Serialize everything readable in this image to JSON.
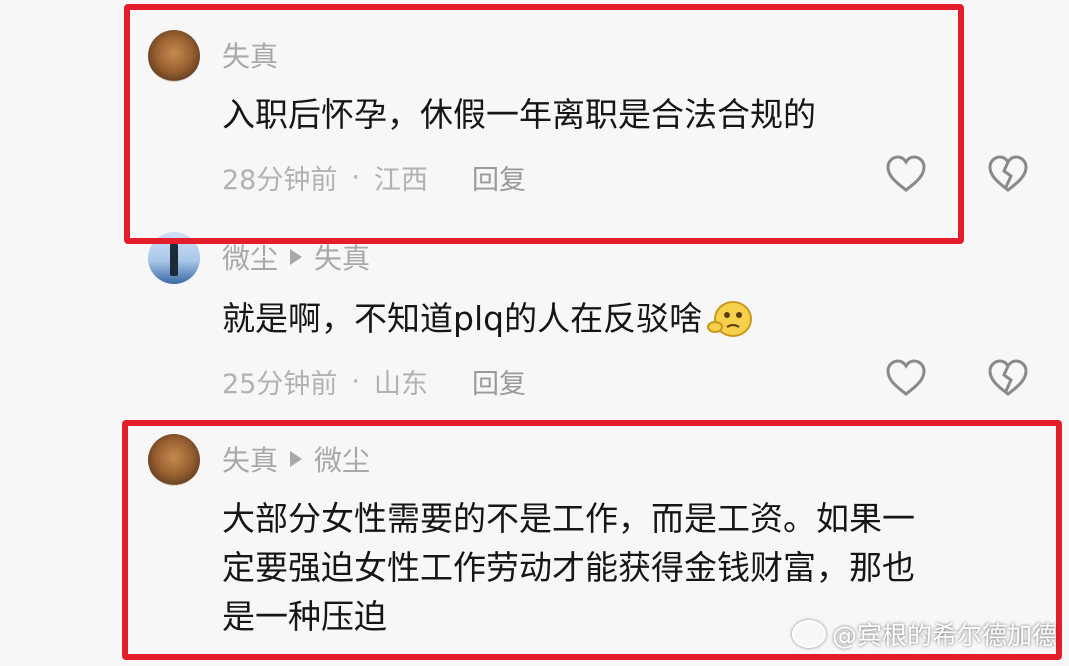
{
  "comments": [
    {
      "author": "失真",
      "reply_to": "",
      "text": "入职后怀孕，休假一年离职是合法合规的",
      "time": "28分钟前",
      "location": "江西",
      "reply_label": "回复",
      "avatar": "cat-avatar"
    },
    {
      "author": "微尘",
      "reply_to": "失真",
      "text": "就是啊，不知道plq的人在反驳啥",
      "time": "25分钟前",
      "location": "山东",
      "reply_label": "回复",
      "avatar": "person-avatar"
    },
    {
      "author": "失真",
      "reply_to": "微尘",
      "text_lines": [
        "大部分女性需要的不是工作，而是工资。如果一",
        "定要强迫女性工作劳动才能获得金钱财富，那也",
        "是一种压迫"
      ],
      "avatar": "cat-avatar"
    }
  ],
  "meta_separator": "·",
  "watermark": "@宾根的希尔德加德",
  "colors": {
    "highlight": "#e21e2b",
    "secondary_text": "#a8a8a8",
    "primary_text": "#161616"
  },
  "icons": [
    "heart-icon",
    "broken-heart-icon",
    "thinking-emoji",
    "reply-arrow-icon",
    "weibo-icon"
  ]
}
